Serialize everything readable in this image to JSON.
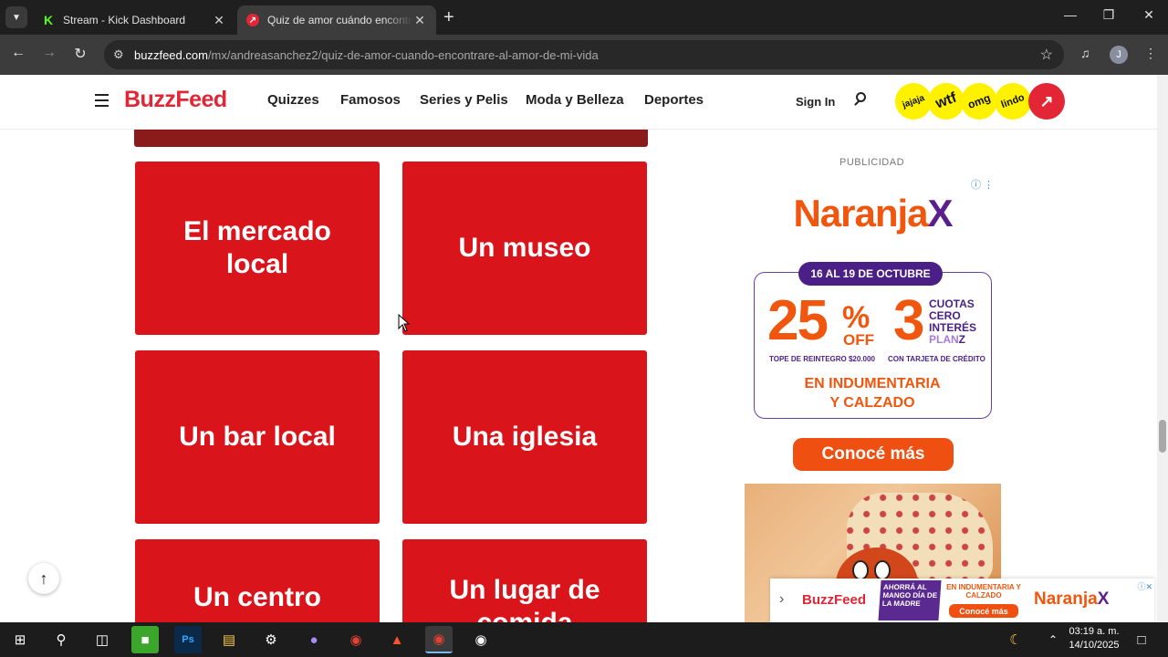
{
  "browser": {
    "tabs": [
      {
        "title": "Stream - Kick Dashboard",
        "favicon": "kick-icon",
        "active": false
      },
      {
        "title": "Quiz de amor cuándo encontraré",
        "favicon": "buzzfeed-trending-icon",
        "active": true
      }
    ],
    "url": {
      "host": "buzzfeed.com",
      "path": "/mx/andreasanchez2/quiz-de-amor-cuando-encontrare-al-amor-de-mi-vida"
    },
    "profile_initial": "J"
  },
  "site": {
    "logo": "BuzzFeed",
    "nav_links": [
      "Quizzes",
      "Famosos",
      "Series y Pelis",
      "Moda y Belleza",
      "Deportes"
    ],
    "sign_in": "Sign In",
    "badges": [
      "jajaja",
      "wtf",
      "omg",
      "lindo"
    ],
    "brand_color": "#e32636"
  },
  "quiz": {
    "answer_color": "#d9141b",
    "answers": [
      {
        "label": "El mercado local"
      },
      {
        "label": "Un museo"
      },
      {
        "label": "Un bar local"
      },
      {
        "label": "Una iglesia"
      },
      {
        "label": "Un centro"
      },
      {
        "label": "Un lugar de comida"
      }
    ]
  },
  "ad": {
    "label": "PUBLICIDAD",
    "brand": "Naranja",
    "brand_x": "X",
    "dates": "16 AL 19 DE OCTUBRE",
    "percent": "25",
    "percent_sign": "%",
    "off": "OFF",
    "installments": "3",
    "installments_text": [
      "CUOTAS",
      "CERO",
      "INTERÉS"
    ],
    "plan": "PLAN",
    "plan_z": "Z",
    "fine_left": "TOPE DE REINTEGRO $20.000",
    "fine_right": "CON TARJETA DE CRÉDITO",
    "category_line1": "EN INDUMENTARIA",
    "category_line2": "Y CALZADO",
    "cta": "Conocé más",
    "accent_orange": "#f0560e",
    "accent_purple": "#4a1f86"
  },
  "banner_ad": {
    "logo": "BuzzFeed",
    "promo_lines": "AHORRÁ AL MANGO DÍA DE LA MADRE",
    "category": "EN INDUMENTARIA Y CALZADO",
    "cta": "Conocé más",
    "brand": "Naranja",
    "brand_x": "X"
  },
  "taskbar": {
    "time": "03:19 a. m.",
    "date": "14/10/2025"
  }
}
